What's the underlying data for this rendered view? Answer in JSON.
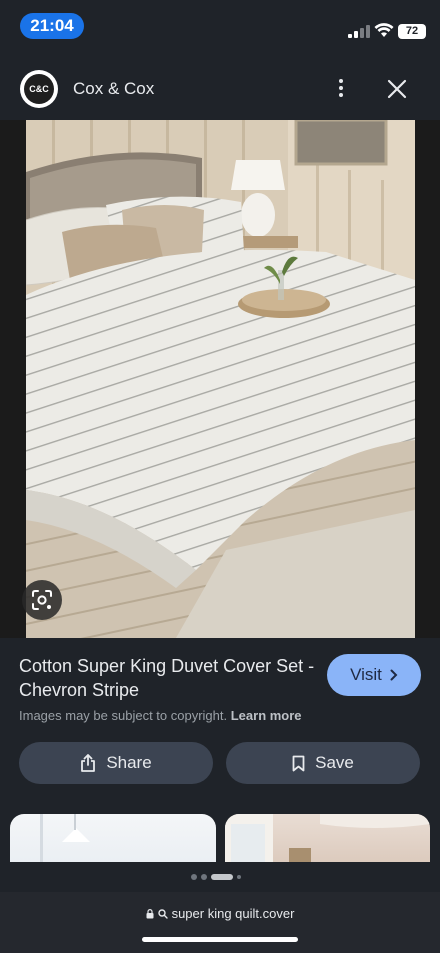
{
  "status": {
    "time": "21:04",
    "battery": "72"
  },
  "header": {
    "site_name": "Cox & Cox",
    "logo_text": "C&C"
  },
  "product": {
    "title": "Cotton Super King Duvet Cover Set - Chevron Stripe",
    "visit_label": "Visit",
    "copyright": "Images may be subject to copyright.",
    "learn_more": "Learn more"
  },
  "actions": {
    "share_label": "Share",
    "save_label": "Save"
  },
  "url_bar": {
    "query": "super king quilt.cover"
  },
  "colors": {
    "accent": "#8ab4f8",
    "background": "#1f2329",
    "time_pill": "#1a73e8"
  }
}
